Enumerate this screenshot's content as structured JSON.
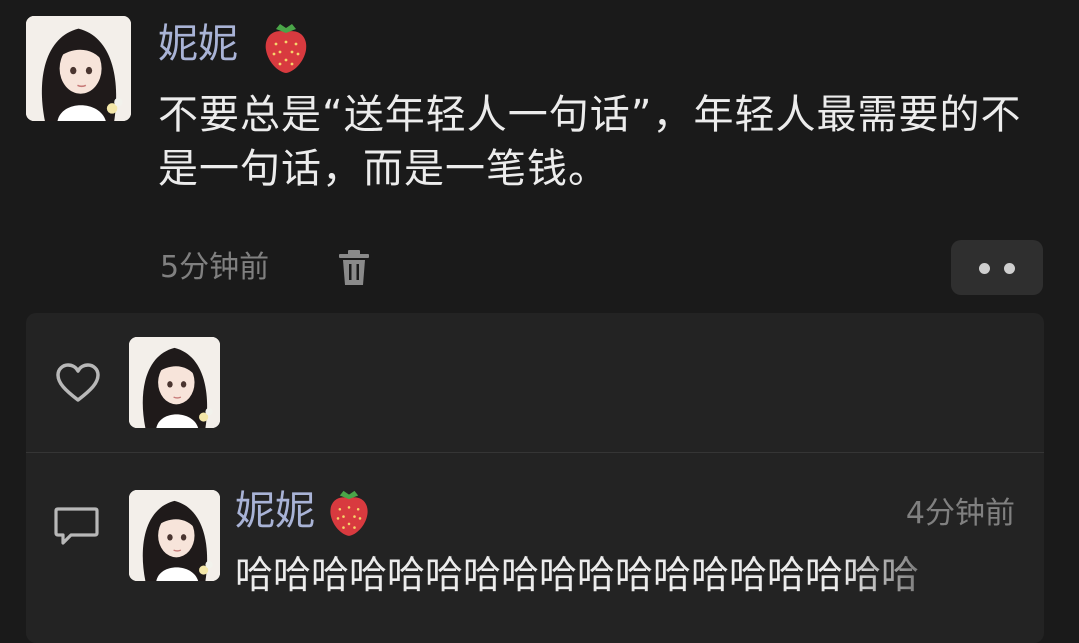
{
  "post": {
    "author_name": "妮妮",
    "author_badge_icon": "strawberry-emoji",
    "text": "不要总是“送年轻人一句话”，年轻人最需要的不是一句话，而是一笔钱。",
    "time": "5分钟前",
    "delete_icon": "trash-icon",
    "more_icon": "more-dots-icon"
  },
  "likes": {
    "icon": "heart-outline-icon"
  },
  "comment": {
    "icon": "comment-bubble-icon",
    "author_name": "妮妮",
    "author_badge_icon": "strawberry-emoji",
    "time": "4分钟前",
    "text": "哈哈哈哈哈哈哈哈哈哈哈哈哈哈哈哈哈哈"
  },
  "colors": {
    "background": "#1a1a1a",
    "panel": "#232323",
    "name": "#a9b3d6",
    "muted": "#808080",
    "text": "#ececec"
  }
}
